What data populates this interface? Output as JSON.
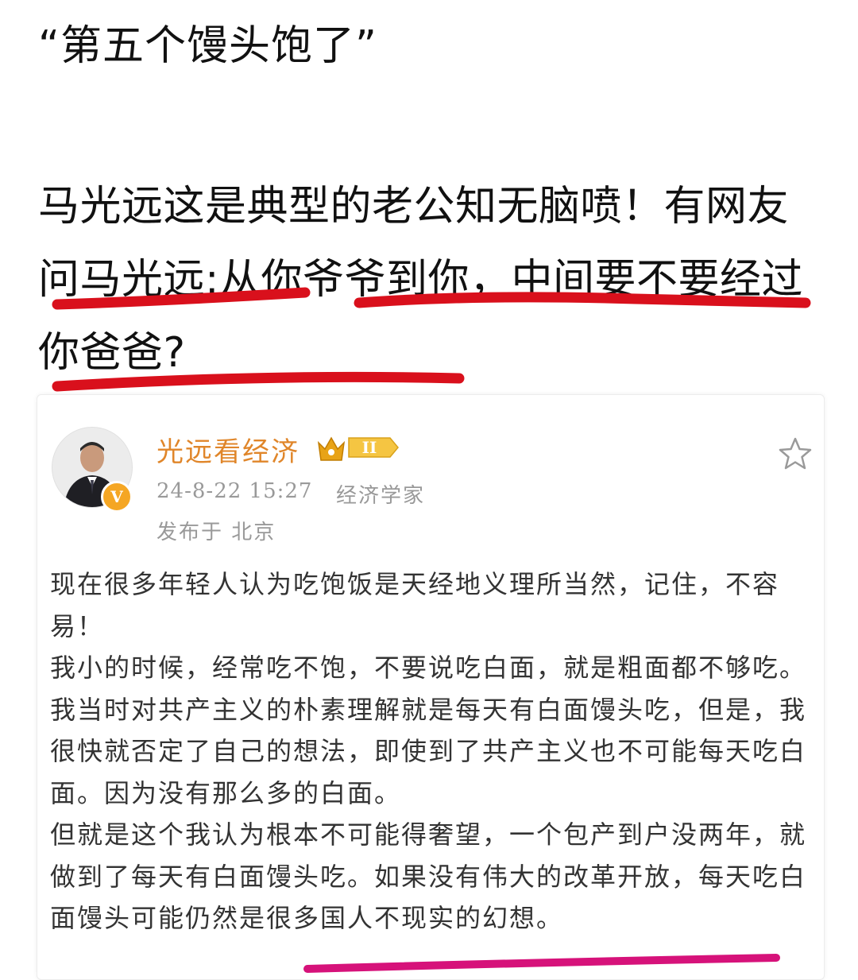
{
  "headline": "“第五个馒头饱了”",
  "main_text": "马光远这是典型的老公知无脑喷！有网友问马光远:从你爷爷到你，中间要不要经过你爸爸?",
  "post": {
    "username": "光远看经济",
    "rank_badge": "II",
    "verified_mark": "V",
    "timestamp": "24-8-22 15:27",
    "role": "经济学家",
    "location": "发布于 北京",
    "paragraphs": [
      "现在很多年轻人认为吃饱饭是天经地义理所当然，记住，不容易！",
      "我小的时候，经常吃不饱，不要说吃白面，就是粗面都不够吃。我当时对共产主义的朴素理解就是每天有白面馒头吃，但是，我很快就否定了自己的想法，即使到了共产主义也不可能每天吃白面。因为没有那么多的白面。",
      "但就是这个我认为根本不可能得奢望，一个包产到户没两年，就做到了每天有白面馒头吃。如果没有伟大的改革开放，每天吃白面馒头可能仍然是很多国人不现实的幻想。"
    ]
  },
  "icons": {
    "avatar": "avatar-photo",
    "verified": "verified-badge-icon",
    "rank": "crown-rank-icon",
    "favorite": "star-icon"
  },
  "colors": {
    "underline_red": "#d9101c",
    "underline_pink": "#d6127a",
    "username_orange": "#e0862a",
    "badge_gold": "#f5a623"
  }
}
